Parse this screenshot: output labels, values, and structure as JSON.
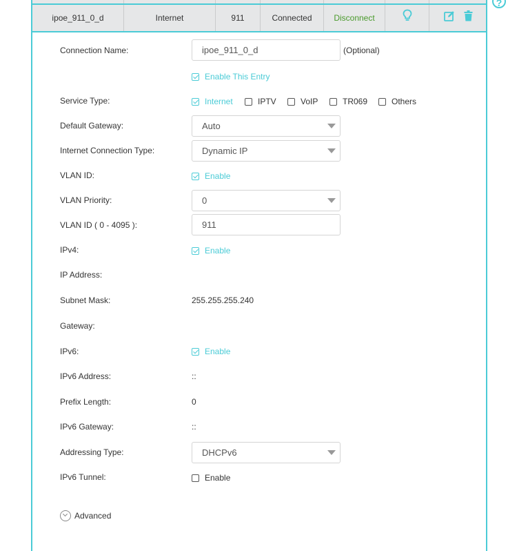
{
  "summary": {
    "name": "ipoe_911_0_d",
    "service": "Internet",
    "vlan": "911",
    "status": "Connected",
    "action": "Disconnect"
  },
  "form": {
    "connection_name": {
      "label": "Connection Name:",
      "value": "ipoe_911_0_d",
      "optional": "(Optional)"
    },
    "enable_entry": {
      "label": "Enable This Entry",
      "checked": true
    },
    "service_type": {
      "label": "Service Type:",
      "options": [
        {
          "label": "Internet",
          "checked": true
        },
        {
          "label": "IPTV",
          "checked": false
        },
        {
          "label": "VoIP",
          "checked": false
        },
        {
          "label": "TR069",
          "checked": false
        },
        {
          "label": "Others",
          "checked": false
        }
      ]
    },
    "default_gateway": {
      "label": "Default Gateway:",
      "value": "Auto"
    },
    "connection_type": {
      "label": "Internet Connection Type:",
      "value": "Dynamic IP"
    },
    "vlan_id_enable": {
      "label": "VLAN ID:",
      "option": "Enable",
      "checked": true
    },
    "vlan_priority": {
      "label": "VLAN Priority:",
      "value": "0"
    },
    "vlan_id_value": {
      "label": "VLAN ID ( 0 - 4095 ):",
      "value": "911"
    },
    "ipv4": {
      "label": "IPv4:",
      "option": "Enable",
      "checked": true
    },
    "ip_address": {
      "label": "IP Address:",
      "value": ""
    },
    "subnet_mask": {
      "label": "Subnet Mask:",
      "value": "255.255.255.240"
    },
    "gateway": {
      "label": "Gateway:",
      "value": ""
    },
    "ipv6": {
      "label": "IPv6:",
      "option": "Enable",
      "checked": true
    },
    "ipv6_address": {
      "label": "IPv6 Address:",
      "value": "::"
    },
    "prefix_length": {
      "label": "Prefix Length:",
      "value": "0"
    },
    "ipv6_gateway": {
      "label": "IPv6 Gateway:",
      "value": "::"
    },
    "addressing_type": {
      "label": "Addressing Type:",
      "value": "DHCPv6"
    },
    "ipv6_tunnel": {
      "label": "IPv6 Tunnel:",
      "option": "Enable",
      "checked": false
    },
    "advanced": "Advanced"
  },
  "colors": {
    "accent": "#4acbd6",
    "disconnect": "#4a9a2c",
    "row_bg": "#e6e7e8"
  },
  "icons": {
    "help": "help-circle-icon",
    "light": "lightbulb-icon",
    "edit": "edit-icon",
    "delete": "trash-icon",
    "advanced": "chevron-down-circle-icon"
  }
}
